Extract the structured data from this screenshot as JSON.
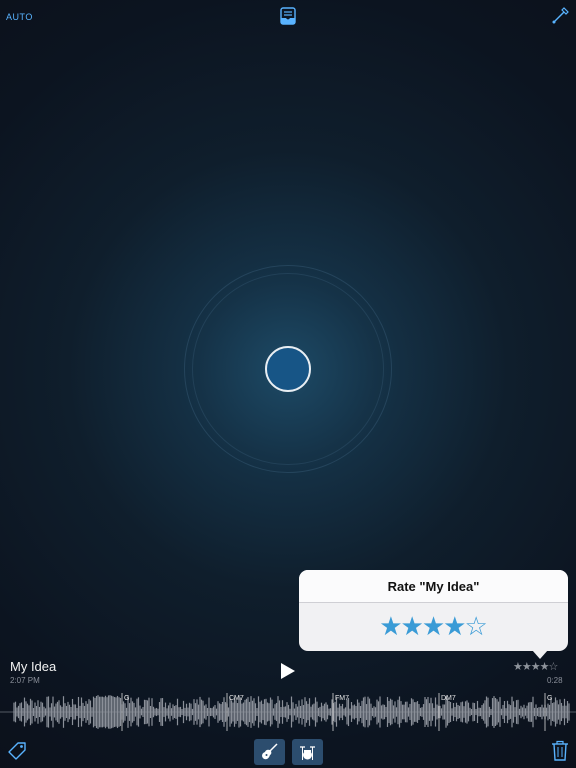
{
  "topbar": {
    "auto_label": "AUTO",
    "library_icon": "library-icon",
    "tuner_icon": "tuner-icon"
  },
  "recorder": {
    "record_icon": "record-button"
  },
  "rating_popover": {
    "title": "Rate \"My Idea\"",
    "stars": [
      "★",
      "★",
      "★",
      "★",
      "☆"
    ],
    "rating": 4,
    "max_rating": 5,
    "filled_color": "#3a9bd6",
    "empty_color": "#3a9bd6"
  },
  "recording": {
    "title": "My Idea",
    "time": "2:07 PM",
    "duration": "0:28",
    "mini_rating": "★★★★☆",
    "chords": [
      "G",
      "CM7",
      "FM7",
      "DM7",
      "G"
    ]
  },
  "bottombar": {
    "tag_icon": "tag-icon",
    "guitar_icon": "guitar-icon",
    "drums_icon": "drums-icon",
    "trash_icon": "trash-icon",
    "active_button_color": "#2c4d6e",
    "accent_color": "#59b3ff"
  }
}
